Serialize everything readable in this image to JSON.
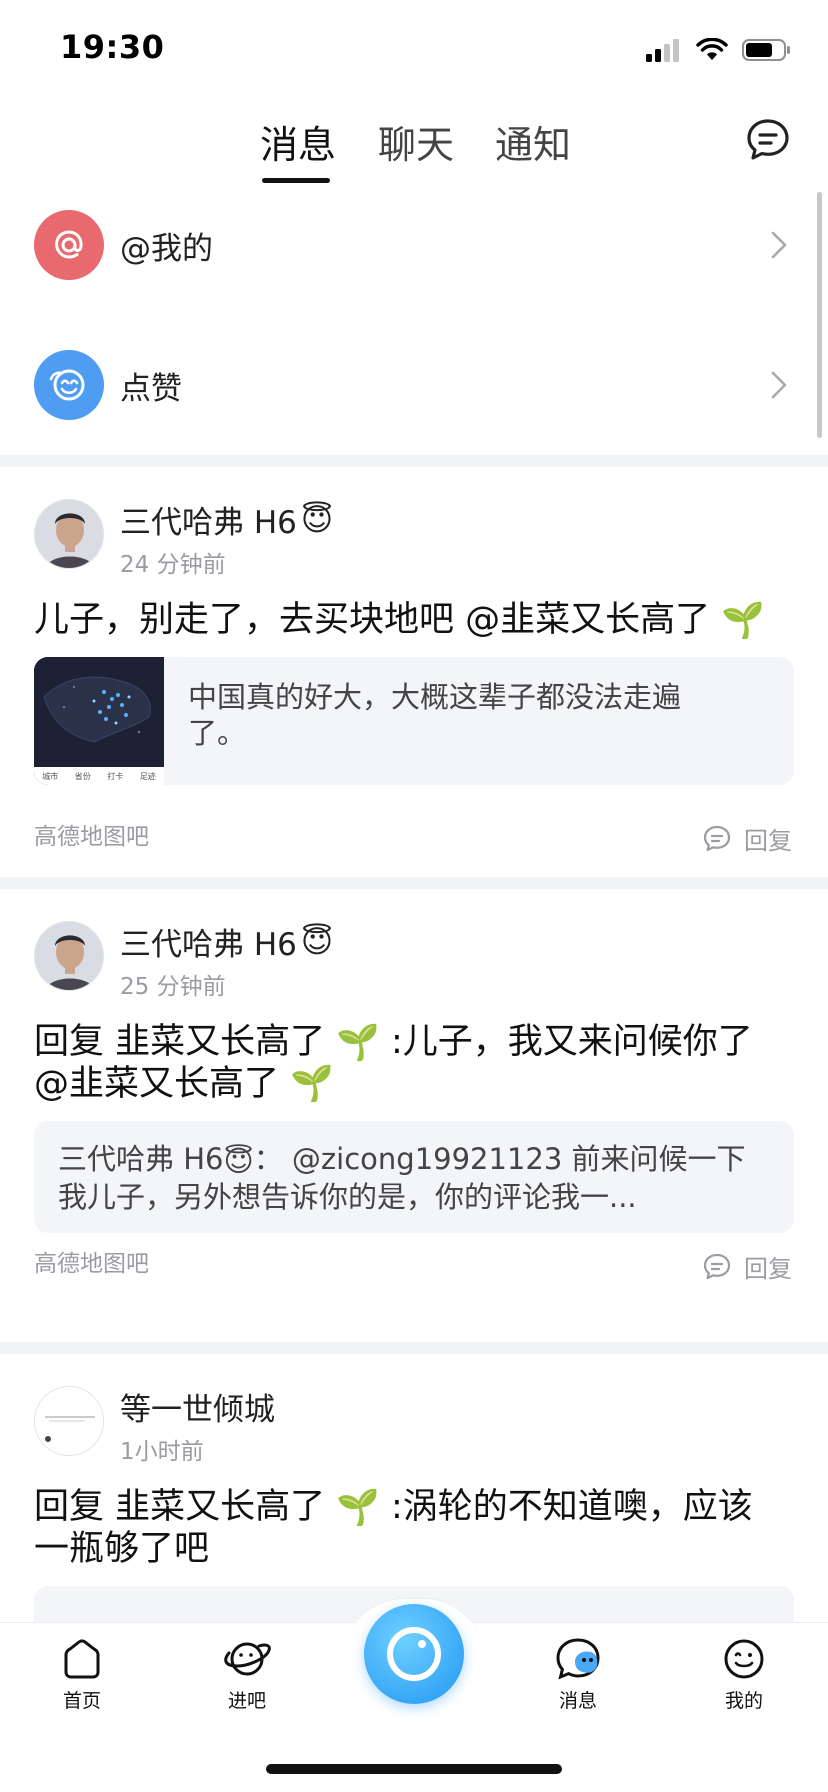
{
  "status_bar": {
    "time": "19:30"
  },
  "top_nav": {
    "tabs": [
      {
        "label": "消息",
        "active": true
      },
      {
        "label": "聊天",
        "active": false
      },
      {
        "label": "通知",
        "active": false
      }
    ],
    "compose_icon": "chat-bubble-icon"
  },
  "entries": [
    {
      "label": "@我的",
      "icon": "at-icon",
      "color": "#e96a6e"
    },
    {
      "label": "点赞",
      "icon": "thumbs-up-icon",
      "color": "#4e9df2"
    }
  ],
  "posts": [
    {
      "author": "三代哈弗 H6",
      "author_emoji": "😇",
      "time": "24 分钟前",
      "text": "儿子，别走了，去买块地吧 @韭菜又长高了",
      "text_emoji": "🌱",
      "quote_text": "中国真的好大，大概这辈子都没法走遍了。",
      "quote_map_tabs": [
        "城市",
        "省份",
        "打卡",
        "足迹"
      ],
      "forum": "高德地图吧",
      "reply_label": "回复"
    },
    {
      "author": "三代哈弗 H6",
      "author_emoji": "😇",
      "time": "25 分钟前",
      "text_line1": "回复  韭菜又长高了",
      "text_line1_suffix": " :儿子，我又来问候你了",
      "text_line2": "@韭菜又长高了",
      "text_emoji": "🌱",
      "quote_author": "三代哈弗 H6",
      "quote_emoji": "😇",
      "quote_text": "： @zicong19921123 前来问候一下我儿子，另外想告诉你的是，你的评论我一...",
      "forum": "高德地图吧",
      "reply_label": "回复"
    },
    {
      "author": "等一世倾城",
      "time": "1小时前",
      "text_line1": "回复  韭菜又长高了",
      "text_line1_suffix": " :涡轮的不知道噢，应该",
      "text_line2": "一瓶够了吧",
      "text_emoji": "🌱"
    }
  ],
  "tab_bar": {
    "items": [
      {
        "label": "首页",
        "icon": "home-icon"
      },
      {
        "label": "进吧",
        "icon": "planet-icon"
      },
      {
        "label": "消息",
        "icon": "message-icon"
      },
      {
        "label": "我的",
        "icon": "profile-icon"
      }
    ],
    "center_icon": "camera-circle-icon",
    "accent": "#2196f3"
  }
}
